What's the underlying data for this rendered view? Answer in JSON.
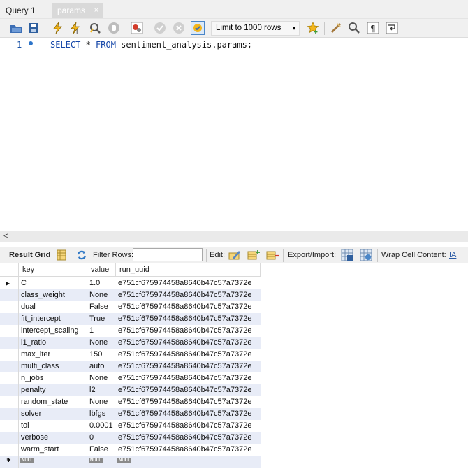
{
  "tabs": [
    {
      "label": "Query 1"
    },
    {
      "label": "params"
    }
  ],
  "tab_close": "×",
  "toolbar": {
    "limit_label": "Limit to 1000 rows",
    "limit_arrow": "▾"
  },
  "editor": {
    "line_number": "1",
    "kw_select": "SELECT",
    "star": " * ",
    "kw_from": "FROM",
    "table": " sentiment_analysis.params;"
  },
  "scroll": {
    "left_arrow": "<"
  },
  "results": {
    "result_grid_label": "Result Grid",
    "filter_rows_label": "Filter Rows:",
    "filter_value": "",
    "edit_label": "Edit:",
    "export_label": "Export/Import:",
    "wrap_label": "Wrap Cell Content:",
    "wrap_icon": "IA",
    "columns": [
      "key",
      "value",
      "run_uuid"
    ],
    "rows": [
      [
        "C",
        "1.0",
        "e751cf675974458a8640b47c57a7372e"
      ],
      [
        "class_weight",
        "None",
        "e751cf675974458a8640b47c57a7372e"
      ],
      [
        "dual",
        "False",
        "e751cf675974458a8640b47c57a7372e"
      ],
      [
        "fit_intercept",
        "True",
        "e751cf675974458a8640b47c57a7372e"
      ],
      [
        "intercept_scaling",
        "1",
        "e751cf675974458a8640b47c57a7372e"
      ],
      [
        "l1_ratio",
        "None",
        "e751cf675974458a8640b47c57a7372e"
      ],
      [
        "max_iter",
        "150",
        "e751cf675974458a8640b47c57a7372e"
      ],
      [
        "multi_class",
        "auto",
        "e751cf675974458a8640b47c57a7372e"
      ],
      [
        "n_jobs",
        "None",
        "e751cf675974458a8640b47c57a7372e"
      ],
      [
        "penalty",
        "l2",
        "e751cf675974458a8640b47c57a7372e"
      ],
      [
        "random_state",
        "None",
        "e751cf675974458a8640b47c57a7372e"
      ],
      [
        "solver",
        "lbfgs",
        "e751cf675974458a8640b47c57a7372e"
      ],
      [
        "tol",
        "0.0001",
        "e751cf675974458a8640b47c57a7372e"
      ],
      [
        "verbose",
        "0",
        "e751cf675974458a8640b47c57a7372e"
      ],
      [
        "warm_start",
        "False",
        "e751cf675974458a8640b47c57a7372e"
      ]
    ],
    "null_label": "NULL",
    "current_row_marker": "▶",
    "new_row_marker": "✱"
  }
}
